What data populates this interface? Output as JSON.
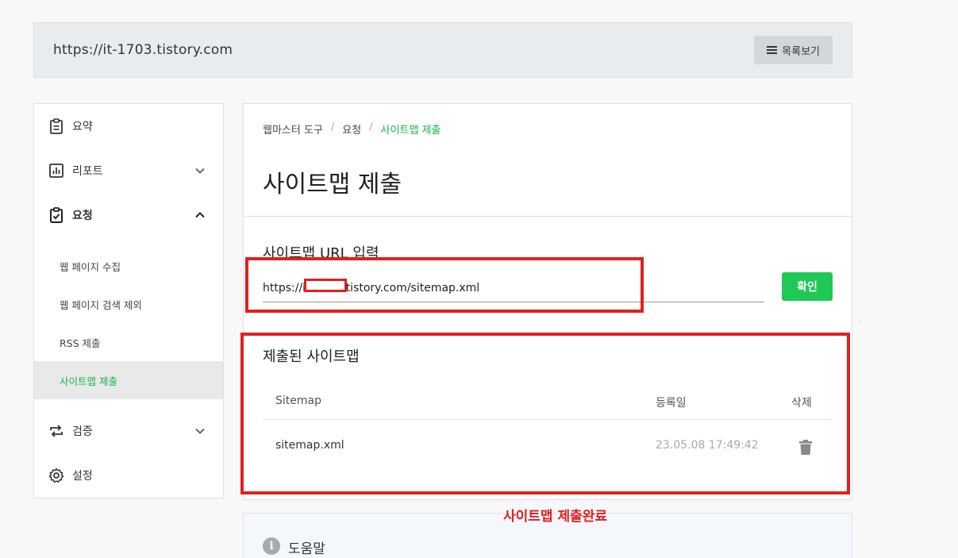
{
  "site": {
    "url": "https://it-1703.tistory.com",
    "list_button_label": "목록보기"
  },
  "sidebar": {
    "items": [
      {
        "label": "요약"
      },
      {
        "label": "리포트"
      },
      {
        "label": "요청"
      },
      {
        "label": "검증"
      },
      {
        "label": "설정"
      }
    ],
    "sub_items": [
      {
        "label": "웹 페이지 수집"
      },
      {
        "label": "웹 페이지 검색 제외"
      },
      {
        "label": "RSS 제출"
      },
      {
        "label": "사이트맵 제출"
      }
    ]
  },
  "breadcrumb": {
    "items": [
      "웹마스터 도구",
      "요청",
      "사이트맵 제출"
    ],
    "separator": "/"
  },
  "page": {
    "title": "사이트맵 제출",
    "url_section_label": "사이트맵 URL 입력",
    "url_input_value": "https://it-1703.tistory.com/sitemap.xml",
    "confirm_label": "확인",
    "submitted_label": "제출된 사이트맵"
  },
  "table": {
    "headers": [
      "Sitemap",
      "등록일",
      "삭제"
    ],
    "rows": [
      {
        "sitemap": "sitemap.xml",
        "date": "23.05.08 17:49:42"
      }
    ]
  },
  "help": {
    "icon_glyph": "i",
    "label": "도움말"
  },
  "annotation": {
    "text": "사이트맵 제출완료"
  },
  "colors": {
    "accent_green": "#1ec955",
    "annotation_red": "#e02020"
  }
}
